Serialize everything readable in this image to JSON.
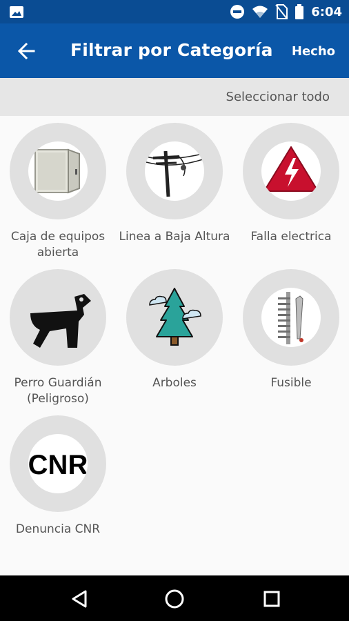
{
  "status_bar": {
    "time": "6:04",
    "icons": [
      "image-icon",
      "do-not-disturb-icon",
      "wifi-icon",
      "no-sim-icon",
      "battery-icon"
    ]
  },
  "toolbar": {
    "back_icon": "back-arrow-icon",
    "title": "Filtrar por Categoría",
    "done_label": "Hecho"
  },
  "select_all_label": "Seleccionar todo",
  "categories": [
    {
      "label": "Caja de equipos\nabierta",
      "icon": "equipment-box-icon"
    },
    {
      "label": "Linea a Baja Altura",
      "icon": "low-power-line-icon"
    },
    {
      "label": "Falla electrica",
      "icon": "electrical-hazard-icon"
    },
    {
      "label": "Perro Guardián\n(Peligroso)",
      "icon": "guard-dog-icon"
    },
    {
      "label": "Arboles",
      "icon": "tree-icon"
    },
    {
      "label": "Fusible",
      "icon": "fuse-icon"
    },
    {
      "label": "Denuncia CNR",
      "icon": "cnr-logo-icon",
      "logo_text": "CNR"
    }
  ],
  "colors": {
    "status_bar": "#0a4c93",
    "toolbar": "#0b57a8",
    "select_bar": "#e6e6e6",
    "circle": "#e0e0e0"
  },
  "nav": {
    "back": "nav-back-icon",
    "home": "nav-home-icon",
    "recents": "nav-recents-icon"
  }
}
